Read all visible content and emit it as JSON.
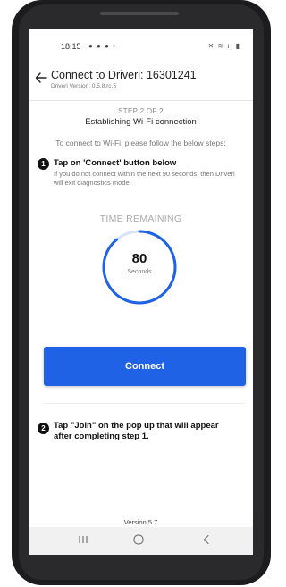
{
  "status_bar": {
    "time": "18:15",
    "left_icons": "● ● ● •",
    "right_icons": "✕ ≋ ıl ▮"
  },
  "app_bar": {
    "title": "Connect to Driveri: 16301241",
    "subtitle": "Driveri Version: 0.5.8.rc.5"
  },
  "step_header": {
    "label": "STEP 2 OF 2",
    "title": "Establishing Wi-Fi connection"
  },
  "instruction": "To connect to Wi-Fi, please follow the below steps:",
  "steps": [
    {
      "number": "1",
      "title": "Tap on 'Connect' button below",
      "description": "If you do not connect within the next 90 seconds, then Driveri will exit diagnostics mode."
    },
    {
      "number": "2",
      "title": "Tap \"Join\" on the pop up that will appear after completing step 1."
    }
  ],
  "timer": {
    "heading": "TIME REMAINING",
    "value": "80",
    "unit": "Seconds",
    "remaining_fraction": 0.889,
    "ring_color": "#1f62e6",
    "track_color": "#d7e3fb"
  },
  "connect_button": {
    "label": "Connect",
    "color": "#1f62e6"
  },
  "footer": {
    "version": "Version 5.7"
  },
  "nav_bar": {
    "recent_label": "III",
    "home_icon": "home-icon",
    "back_icon": "back-chevron-icon"
  }
}
